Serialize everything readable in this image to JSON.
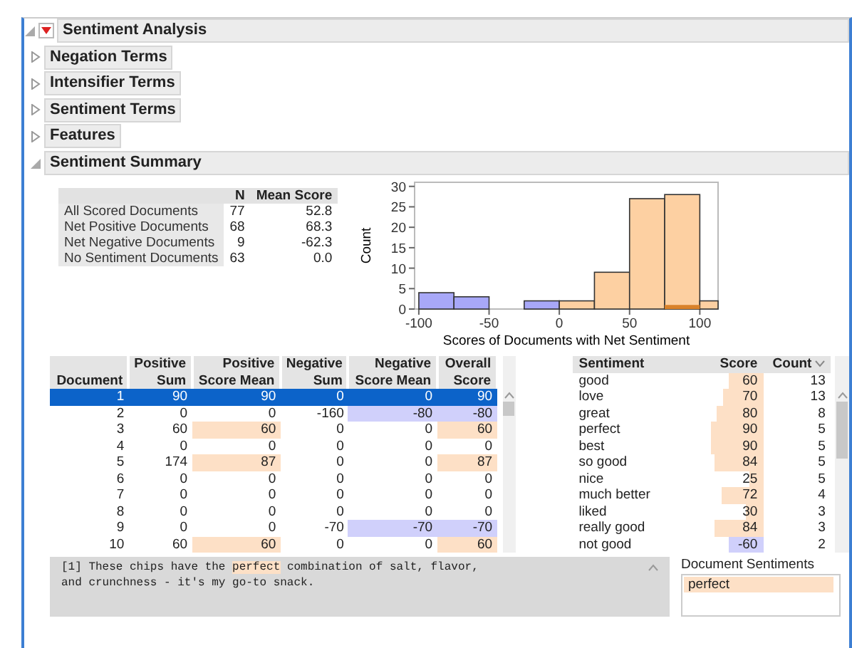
{
  "report": {
    "title": "Sentiment Analysis",
    "expanded": true
  },
  "outlines": [
    {
      "title": "Negation Terms",
      "expanded": false
    },
    {
      "title": "Intensifier Terms",
      "expanded": false
    },
    {
      "title": "Sentiment Terms",
      "expanded": false
    },
    {
      "title": "Features",
      "expanded": false
    }
  ],
  "summary": {
    "title": "Sentiment Summary",
    "expanded": true,
    "table": {
      "columns": [
        "N",
        "Mean Score"
      ],
      "rows": [
        {
          "label": "All Scored Documents",
          "n": "77",
          "mean": "52.8"
        },
        {
          "label": "Net Positive Documents",
          "n": "68",
          "mean": "68.3"
        },
        {
          "label": "Net Negative Documents",
          "n": "9",
          "mean": "-62.3"
        },
        {
          "label": "No Sentiment Documents",
          "n": "63",
          "mean": "0.0"
        }
      ]
    },
    "chart": {
      "chart_data": {
        "type": "bar",
        "xlabel": "Scores of Documents with Net Sentiment",
        "ylabel": "Count",
        "x": [
          -87.5,
          -62.5,
          null,
          -12.5,
          12.5,
          37.5,
          62.5,
          87.5,
          112.5
        ],
        "series": [
          {
            "color": "#a8a8f8",
            "values": [
              4,
              3,
              null,
              2,
              null,
              null,
              null,
              null,
              null
            ]
          },
          {
            "color": "#fdd0a2",
            "values": [
              null,
              null,
              null,
              null,
              2,
              9,
              27,
              28,
              2
            ]
          },
          {
            "color": "#d9822b",
            "values": [
              null,
              null,
              null,
              null,
              null,
              null,
              null,
              1,
              null
            ]
          }
        ],
        "xlim": [
          -103,
          113
        ],
        "ylim": [
          0,
          31
        ],
        "xticks": [
          -100,
          -50,
          0,
          50,
          100
        ],
        "yticks": [
          0,
          5,
          10,
          15,
          20,
          25,
          30
        ]
      }
    }
  },
  "documents": {
    "columns": [
      "Document",
      "Positive\nSum",
      "Positive\nScore Mean",
      "Negative\nSum",
      "Negative\nScore Mean",
      "Overall\nScore"
    ],
    "rows": [
      {
        "selected": true,
        "cells": [
          "1",
          "90",
          "90",
          "0",
          "0",
          "90"
        ]
      },
      {
        "selected": false,
        "cells": [
          "2",
          "0",
          "0",
          "-160",
          "-80",
          "-80"
        ]
      },
      {
        "selected": false,
        "cells": [
          "3",
          "60",
          "60",
          "0",
          "0",
          "60"
        ]
      },
      {
        "selected": false,
        "cells": [
          "4",
          "0",
          "0",
          "0",
          "0",
          "0"
        ]
      },
      {
        "selected": false,
        "cells": [
          "5",
          "174",
          "87",
          "0",
          "0",
          "87"
        ]
      },
      {
        "selected": false,
        "cells": [
          "6",
          "0",
          "0",
          "0",
          "0",
          "0"
        ]
      },
      {
        "selected": false,
        "cells": [
          "7",
          "0",
          "0",
          "0",
          "0",
          "0"
        ]
      },
      {
        "selected": false,
        "cells": [
          "8",
          "0",
          "0",
          "0",
          "0",
          "0"
        ]
      },
      {
        "selected": false,
        "cells": [
          "9",
          "0",
          "0",
          "-70",
          "-70",
          "-70"
        ]
      },
      {
        "selected": false,
        "cells": [
          "10",
          "60",
          "60",
          "0",
          "0",
          "60"
        ]
      }
    ]
  },
  "terms": {
    "columns": [
      "Sentiment",
      "Score",
      "Count"
    ],
    "rows": [
      {
        "term": "good",
        "score": "60",
        "count": "13"
      },
      {
        "term": "love",
        "score": "70",
        "count": "13"
      },
      {
        "term": "great",
        "score": "80",
        "count": "8"
      },
      {
        "term": "perfect",
        "score": "90",
        "count": "5"
      },
      {
        "term": "best",
        "score": "90",
        "count": "5"
      },
      {
        "term": "so good",
        "score": "84",
        "count": "5"
      },
      {
        "term": "nice",
        "score": "25",
        "count": "5"
      },
      {
        "term": "much better",
        "score": "72",
        "count": "4"
      },
      {
        "term": "liked",
        "score": "30",
        "count": "3"
      },
      {
        "term": "really good",
        "score": "84",
        "count": "3"
      },
      {
        "term": "not good",
        "score": "-60",
        "count": "2"
      }
    ]
  },
  "document_text": {
    "segments": [
      {
        "text": "[1] These chips have the ",
        "highlighted": false
      },
      {
        "text": "perfect",
        "highlighted": true
      },
      {
        "text": " combination of salt, flavor, and crunchness - it's my go-to snack.",
        "highlighted": false
      }
    ]
  },
  "document_sentiments": {
    "title": "Document Sentiments",
    "items": [
      "perfect"
    ]
  }
}
